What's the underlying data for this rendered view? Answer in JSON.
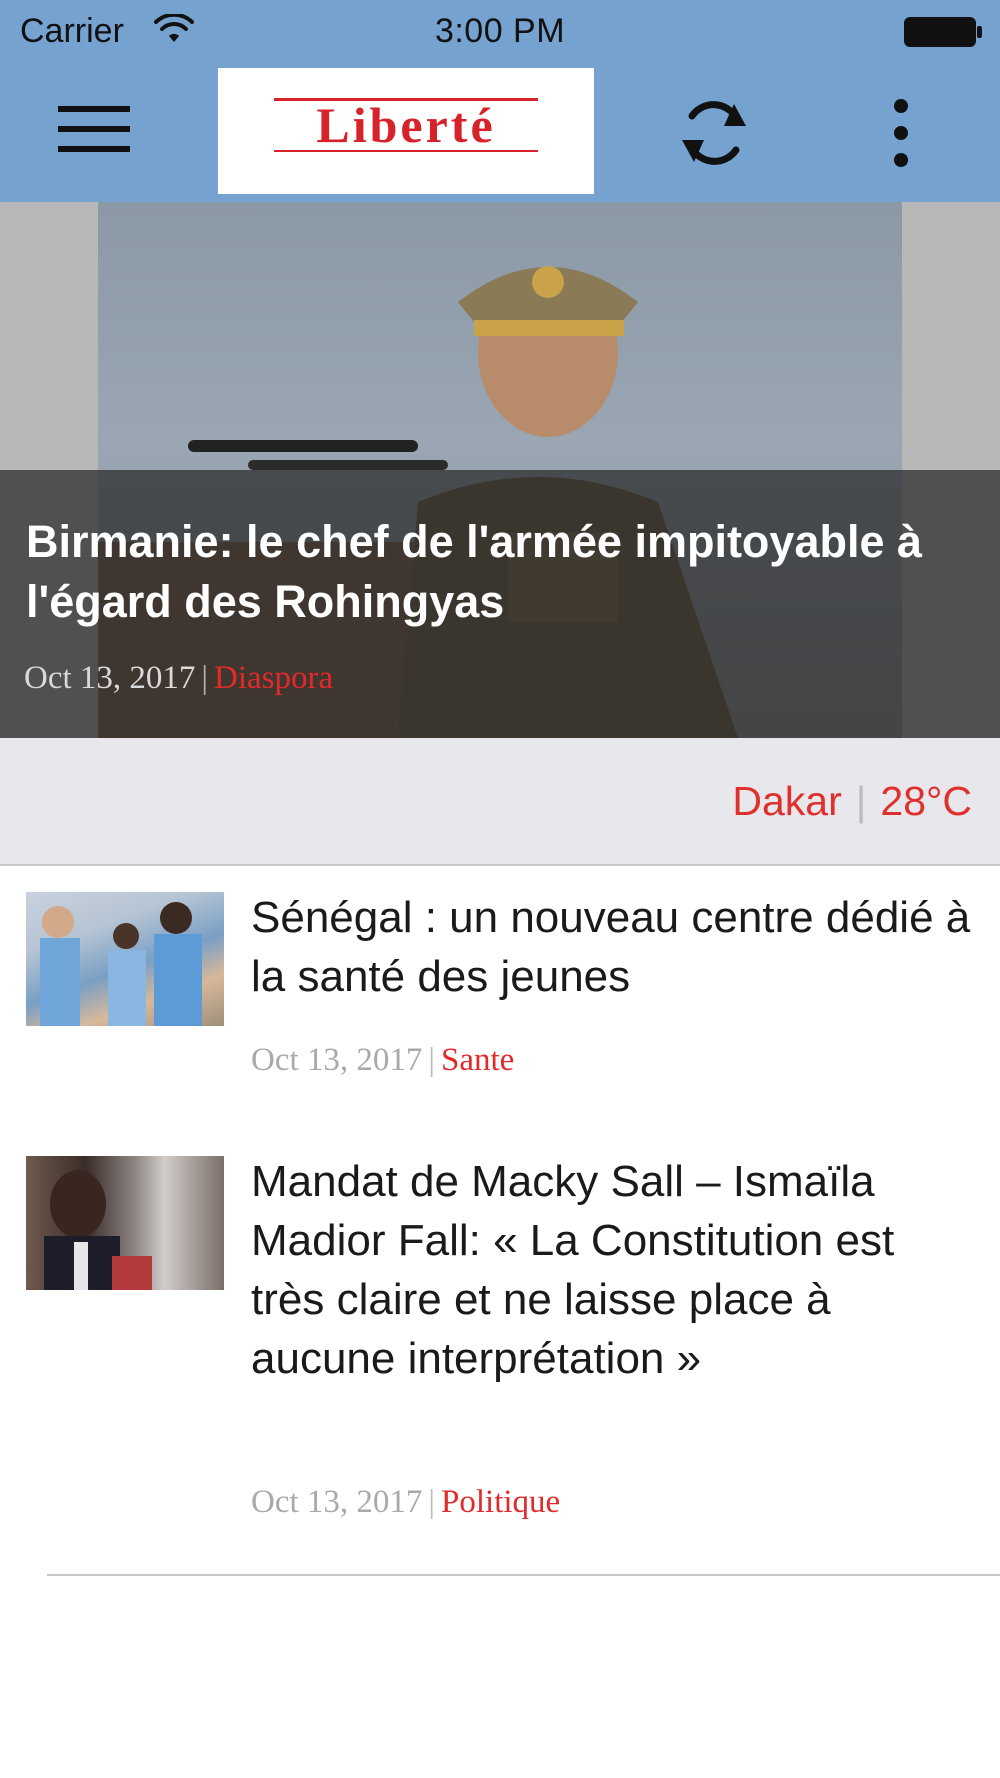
{
  "status_bar": {
    "carrier": "Carrier",
    "time": "3:00 PM"
  },
  "nav": {
    "logo_text": "Liberté",
    "icons": [
      "hamburger-menu-icon",
      "refresh-icon",
      "more-vertical-icon"
    ]
  },
  "hero": {
    "title": "Birmanie: le chef de l'armée impitoyable à l'égard des Rohingyas",
    "date": "Oct 13, 2017",
    "separator": "|",
    "category": "Diaspora"
  },
  "weather": {
    "city": "Dakar",
    "separator": "|",
    "temperature": "28°C"
  },
  "articles": [
    {
      "title": "Sénégal : un nouveau centre dédié à la santé des jeunes",
      "date": "Oct 13, 2017",
      "separator": "|",
      "category": "Sante"
    },
    {
      "title": "Mandat de Macky Sall – Ismaïla Madior Fall: « La Constitution est très claire et ne laisse place à aucune interprétation »",
      "date": "Oct 13, 2017",
      "separator": "|",
      "category": "Politique"
    }
  ],
  "colors": {
    "nav_background": "#76a2cf",
    "accent_red": "#e22a2a",
    "logo_red": "#d6232a",
    "weather_strip": "#e8e8ec"
  }
}
